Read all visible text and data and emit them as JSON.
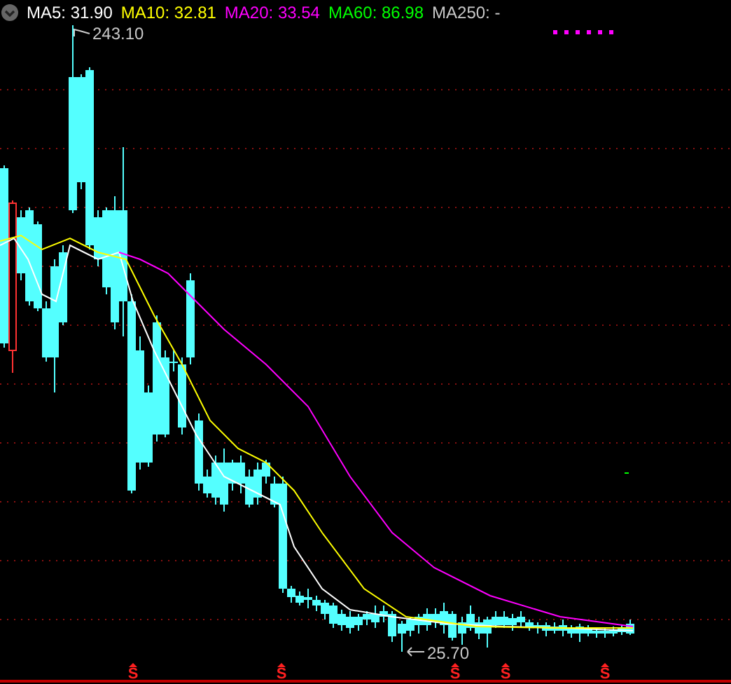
{
  "legend": [
    {
      "label": "MA5: 31.90",
      "color": "#ffffff"
    },
    {
      "label": "MA10: 32.81",
      "color": "#ffff00"
    },
    {
      "label": "MA20: 33.54",
      "color": "#ff00ff"
    },
    {
      "label": "MA60: 86.98",
      "color": "#00ff00"
    },
    {
      "label": "MA250: -",
      "color": "#c8c8c8"
    }
  ],
  "chart": {
    "high_label": "243.10",
    "low_label": "25.70",
    "event_markers": [
      "S",
      "S",
      "S",
      "S",
      "S"
    ]
  }
}
